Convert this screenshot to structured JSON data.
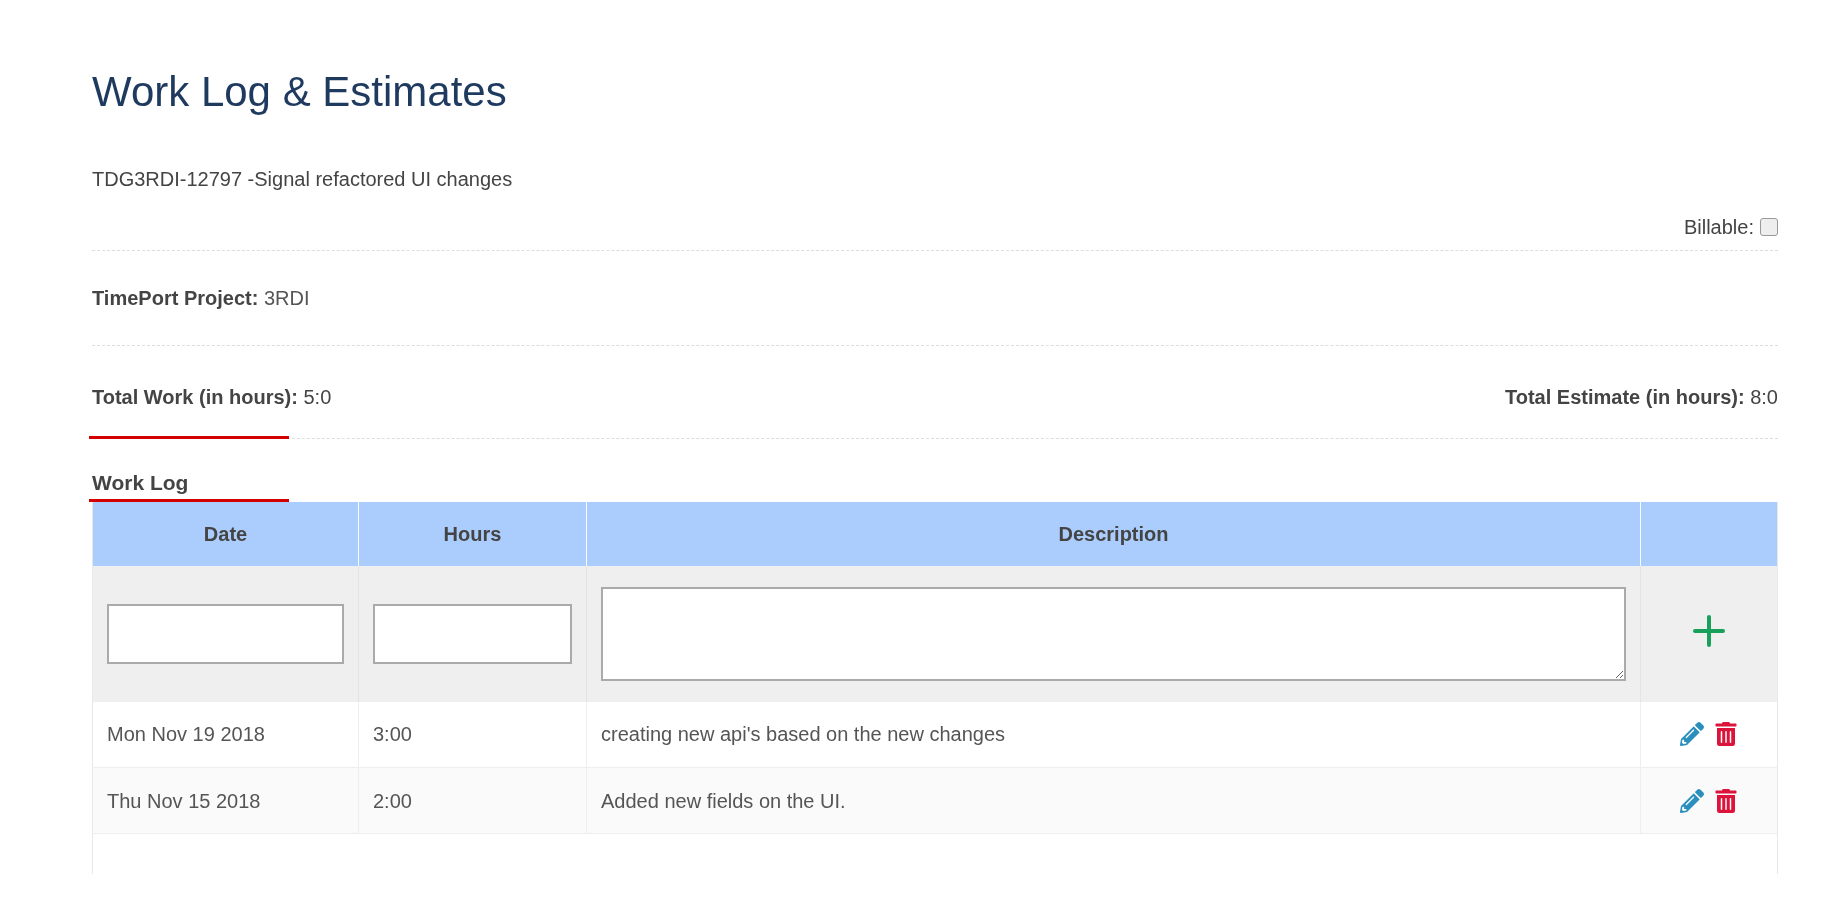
{
  "title": "Work Log & Estimates",
  "task": "TDG3RDI-12797 -Signal refactored UI changes",
  "billable": {
    "label": "Billable:",
    "checked": false
  },
  "project": {
    "label": "TimePort Project:",
    "value": "3RDI"
  },
  "total_work": {
    "label": "Total Work (in hours):",
    "value": "5:0"
  },
  "total_estimate": {
    "label": "Total Estimate (in hours):",
    "value": "8:0"
  },
  "work_log": {
    "heading": "Work Log",
    "columns": [
      "Date",
      "Hours",
      "Description"
    ],
    "rows": [
      {
        "date": "Mon Nov 19 2018",
        "hours": "3:00",
        "description": "creating new api's based on the new changes"
      },
      {
        "date": "Thu Nov 15 2018",
        "hours": "2:00",
        "description": "Added new fields on the UI."
      }
    ]
  }
}
